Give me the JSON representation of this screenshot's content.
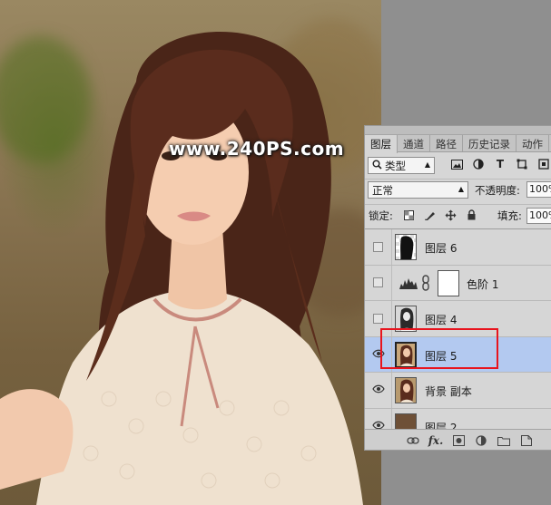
{
  "watermark": {
    "text": "www.240PS.com"
  },
  "panel": {
    "tabs": [
      {
        "label": "图层",
        "active": true
      },
      {
        "label": "通道",
        "active": false
      },
      {
        "label": "路径",
        "active": false
      },
      {
        "label": "历史记录",
        "active": false
      },
      {
        "label": "动作",
        "active": false
      }
    ],
    "filter": {
      "label": "类型",
      "icon": "search-icon"
    },
    "blend": {
      "value": "正常",
      "opacity_label": "不透明度:",
      "opacity_value": "100%"
    },
    "lock": {
      "label": "锁定:",
      "fill_label": "填充:",
      "fill_value": "100%"
    },
    "layers": [
      {
        "name": "图层 6",
        "visible": false,
        "selected": false,
        "thumb": "mask-figure"
      },
      {
        "name": "色阶 1",
        "visible": false,
        "selected": false,
        "thumb": "levels-adjustment"
      },
      {
        "name": "图层 4",
        "visible": false,
        "selected": false,
        "thumb": "bw-figure"
      },
      {
        "name": "图层 5",
        "visible": true,
        "selected": true,
        "thumb": "photo"
      },
      {
        "name": "背景 副本",
        "visible": true,
        "selected": false,
        "thumb": "photo"
      },
      {
        "name": "图层 2",
        "visible": true,
        "selected": false,
        "thumb": "brown-fill"
      }
    ],
    "colors": {
      "selected_row": "#b3c9f0",
      "highlight": "#e8141e",
      "brown_fill": "#6e5037"
    }
  }
}
